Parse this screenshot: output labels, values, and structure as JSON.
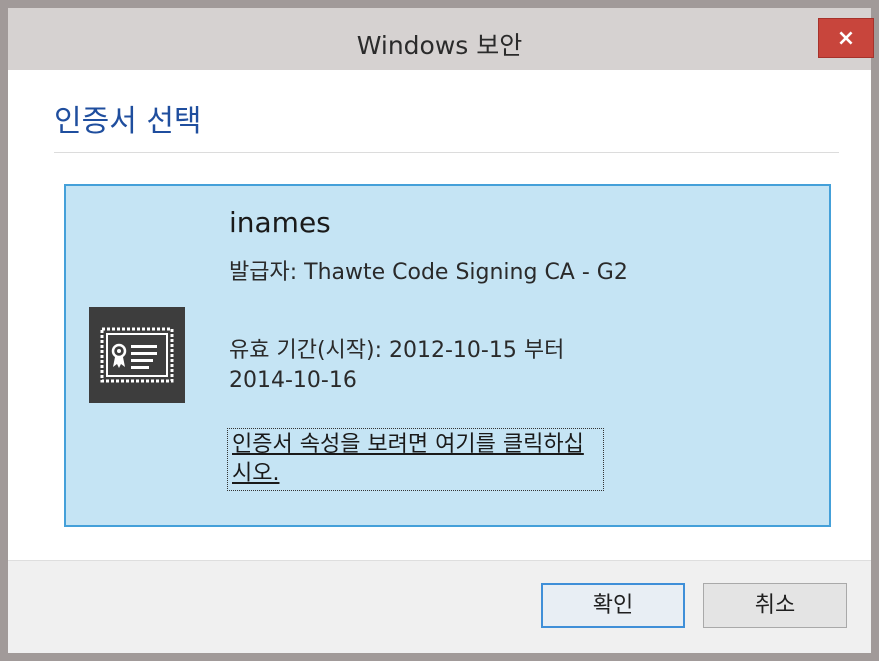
{
  "window": {
    "title": "Windows 보안",
    "close_label": "×"
  },
  "dialog": {
    "heading": "인증서 선택"
  },
  "certificate": {
    "icon": "certificate-icon",
    "name": "inames",
    "issuer": "발급자: Thawte Code Signing CA - G2",
    "validity": "유효 기간(시작): 2012-10-15 부터 2014-10-16",
    "properties_link": "인증서 속성을 보려면 여기를 클릭하십시오."
  },
  "buttons": {
    "ok": "확인",
    "cancel": "취소"
  },
  "colors": {
    "accent": "#1f4e9e",
    "tile_background": "#c5e4f4",
    "tile_border": "#44a0d9",
    "close_button": "#c8453c"
  }
}
